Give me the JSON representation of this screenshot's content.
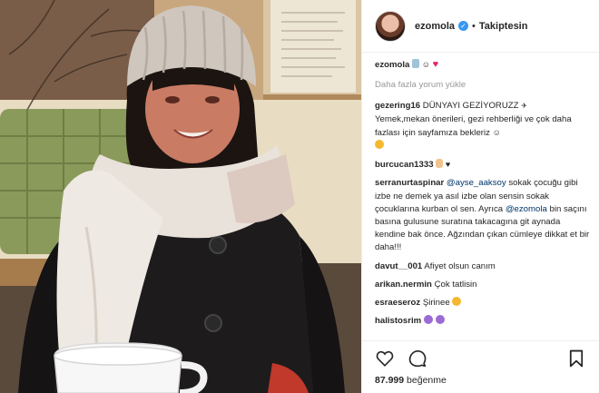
{
  "post": {
    "username": "ezomola",
    "follow_status": "Takiptesin",
    "separator": "•"
  },
  "comments": {
    "caption_user": "ezomola",
    "load_more": "Daha fazla yorum yükle",
    "items": [
      {
        "user": "gezering16",
        "text": "DÜNYAYI GEZİYORUZZ",
        "text2": "Yemek,mekan önerileri, gezi rehberliği ve çok daha fazlası için sayfamıza bekleriz"
      },
      {
        "user": "burcucan1333",
        "text": ""
      },
      {
        "user": "serranurtaspinar",
        "mention1": "@ayse_aaksoy",
        "text1": " sokak çocuğu gibi izbe ne demek ya asıl izbe olan sensin sokak çocuklarına kurban ol sen. Ayrıca ",
        "mention2": "@ezomola",
        "text2": " bin saçını basına gulusune suratına takacagına git aynada kendine bak önce. Ağzından çıkan cümleye dikkat et bir daha!!!"
      },
      {
        "user": "davut__001",
        "text": "Afiyet olsun canım"
      },
      {
        "user": "arikan.nermin",
        "text": "Çok tatlisin"
      },
      {
        "user": "esraeseroz",
        "text": "Şirinee"
      },
      {
        "user": "halistosrim",
        "text": ""
      }
    ]
  },
  "actions": {
    "like_icon": "heart-outline-icon",
    "comment_icon": "comment-bubble-icon",
    "save_icon": "bookmark-icon",
    "likes_count": "87.999",
    "likes_label": "beğenme"
  },
  "colors": {
    "verified": "#3897f0",
    "heart": "#e0245e",
    "muted": "#999999"
  }
}
